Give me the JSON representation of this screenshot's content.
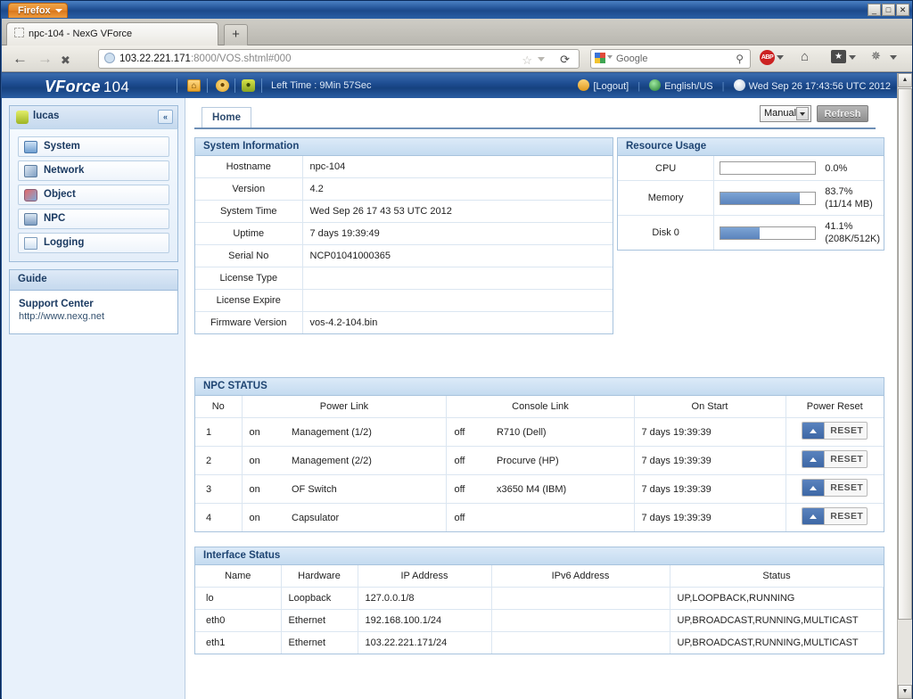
{
  "browser": {
    "app_button": "Firefox",
    "window_controls": {
      "minimize": "_",
      "maximize": "□",
      "close": "✕"
    },
    "tab_title": "npc-104 - NexG VForce",
    "new_tab_label": "+",
    "url_host": "103.22.221.171",
    "url_rest": ":8000/VOS.shtml#000",
    "search_engine": "Google",
    "search_placeholder": "Google",
    "back_glyph": "←",
    "forward_glyph": "→",
    "reload_glyph": "⟳",
    "star_glyph": "☆",
    "magnifier_glyph": "⚲",
    "home_glyph": "⌂",
    "bookmark_glyph": "★",
    "abp_label": "ABP"
  },
  "appheader": {
    "logo_brand": "VForce",
    "logo_model": "104",
    "icons": [
      "home-icon",
      "alert-icon",
      "user-icon"
    ],
    "left_time": "Left Time : 9Min 57Sec",
    "logout": "[Logout]",
    "language": "English/US",
    "datetime": "Wed Sep 26 17:43:56 UTC 2012"
  },
  "sidebar": {
    "user": "lucas",
    "collapse_glyph": "«",
    "items": [
      {
        "label": "System",
        "icon": "monitor-icon"
      },
      {
        "label": "Network",
        "icon": "plug-icon"
      },
      {
        "label": "Object",
        "icon": "objects-icon"
      },
      {
        "label": "NPC",
        "icon": "npc-icon"
      },
      {
        "label": "Logging",
        "icon": "document-icon"
      }
    ],
    "guide_header": "Guide",
    "guide_title": "Support Center",
    "guide_url": "http://www.nexg.net"
  },
  "toolbar": {
    "tab_home": "Home",
    "refresh_mode": "Manual",
    "refresh_label": "Refresh"
  },
  "system_information": {
    "title": "System Information",
    "rows": [
      {
        "label": "Hostname",
        "value": "npc-104"
      },
      {
        "label": "Version",
        "value": "4.2"
      },
      {
        "label": "System Time",
        "value": "Wed Sep 26 17 43 53 UTC 2012"
      },
      {
        "label": "Uptime",
        "value": "7 days 19:39:49"
      },
      {
        "label": "Serial No",
        "value": "NCP01041000365"
      },
      {
        "label": "License Type",
        "value": ""
      },
      {
        "label": "License Expire",
        "value": ""
      },
      {
        "label": "Firmware Version",
        "value": "vos-4.2-104.bin"
      }
    ]
  },
  "resource_usage": {
    "title": "Resource Usage",
    "rows": [
      {
        "label": "CPU",
        "percent": 0.0,
        "percent_text": "0.0%",
        "detail": ""
      },
      {
        "label": "Memory",
        "percent": 83.7,
        "percent_text": "83.7%",
        "detail": "(11/14 MB)"
      },
      {
        "label": "Disk 0",
        "percent": 41.1,
        "percent_text": "41.1%",
        "detail": "(208K/512K)"
      }
    ]
  },
  "npc_status": {
    "title": "NPC STATUS",
    "columns": [
      "No",
      "Power Link",
      "Console Link",
      "On Start",
      "Power Reset"
    ],
    "reset_label": "RESET",
    "rows": [
      {
        "no": "1",
        "power_state": "on",
        "power_name": "Management (1/2)",
        "console_state": "off",
        "console_name": "R710 (Dell)",
        "on_start": "7 days 19:39:39"
      },
      {
        "no": "2",
        "power_state": "on",
        "power_name": "Management (2/2)",
        "console_state": "off",
        "console_name": "Procurve (HP)",
        "on_start": "7 days 19:39:39"
      },
      {
        "no": "3",
        "power_state": "on",
        "power_name": "OF Switch",
        "console_state": "off",
        "console_name": "x3650 M4 (IBM)",
        "on_start": "7 days 19:39:39"
      },
      {
        "no": "4",
        "power_state": "on",
        "power_name": "Capsulator",
        "console_state": "off",
        "console_name": "",
        "on_start": "7 days 19:39:39"
      }
    ]
  },
  "interface_status": {
    "title": "Interface Status",
    "columns": [
      "Name",
      "Hardware",
      "IP Address",
      "IPv6 Address",
      "Status"
    ],
    "rows": [
      {
        "name": "lo",
        "hardware": "Loopback",
        "ip": "127.0.0.1/8",
        "ipv6": "",
        "status": "UP,LOOPBACK,RUNNING"
      },
      {
        "name": "eth0",
        "hardware": "Ethernet",
        "ip": "192.168.100.1/24",
        "ipv6": "",
        "status": "UP,BROADCAST,RUNNING,MULTICAST"
      },
      {
        "name": "eth1",
        "hardware": "Ethernet",
        "ip": "103.22.221.171/24",
        "ipv6": "",
        "status": "UP,BROADCAST,RUNNING,MULTICAST"
      }
    ]
  },
  "scrollbar": {
    "up": "▲",
    "down": "▼"
  },
  "colors": {
    "header_blue": "#1f4e93",
    "panel_border": "#a8c3dd",
    "panel_header": "#c4dbf0",
    "bar_fill": "#5b84bd",
    "label_text": "#1d4b80"
  }
}
